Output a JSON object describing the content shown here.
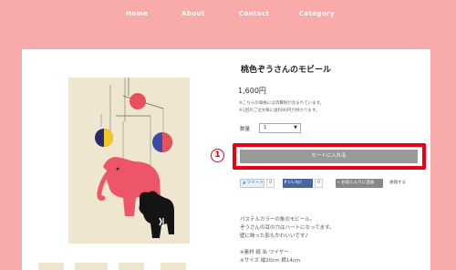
{
  "nav": {
    "home": "Home",
    "about": "About",
    "contact": "Contact",
    "category": "Category"
  },
  "product": {
    "title": "桃色ぞうさんのモビール",
    "price": "1,600円",
    "tax_note": "※こちらの価格には消費税が含まれています。",
    "shipping_note": "※1回のご注文毎に送料80円が掛かります。",
    "qty_label": "数量",
    "qty_value": "1",
    "cart_label": "カートに入れる"
  },
  "annotation": {
    "number": "1"
  },
  "social": {
    "tweet": "ツイート",
    "tweet_count": "0",
    "fb_like": "いいね！",
    "fb_count": "0",
    "favorite": "お気に入りに追加",
    "contact": "通報する"
  },
  "description": {
    "line1": "パステルカラーの象のモビール。",
    "line2": "ぞうさんの耳の穴はハートになってます。",
    "line3": "壁に映った影もかわいいです♪",
    "line4": "※素材  紙  糸  ワイヤー",
    "line5": "※サイズ  縦20cm 横14cm"
  },
  "colors": {
    "background": "#f9abab",
    "highlight": "#e60012",
    "cart_button": "#999999"
  }
}
